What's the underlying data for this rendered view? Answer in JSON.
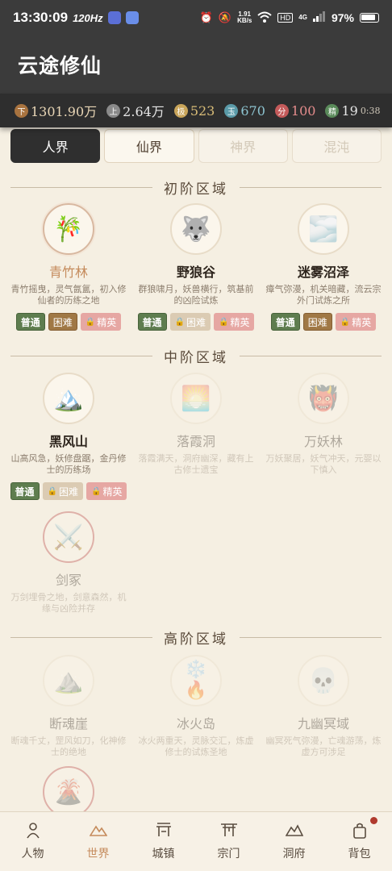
{
  "status_bar": {
    "time": "13:30:09",
    "refresh_rate": "120Hz",
    "net_speed_value": "1.91",
    "net_speed_unit": "KB/s",
    "net_type": "4G",
    "battery": "97%"
  },
  "app": {
    "title": "云途修仙"
  },
  "resources": [
    {
      "icon_text": "下",
      "value": "1301.90万",
      "color": "#a8733f"
    },
    {
      "icon_text": "上",
      "value": "2.64万",
      "color": "#8a8a8a"
    },
    {
      "icon_text": "极",
      "value": "523",
      "color": "#c9a55a"
    },
    {
      "icon_text": "玉",
      "value": "670",
      "color": "#5a9aa8"
    },
    {
      "icon_text": "分",
      "value": "100",
      "color": "#c45a5a"
    },
    {
      "icon_text": "精",
      "value": "19",
      "color": "#5a8a5a"
    }
  ],
  "resource_timer": "0:38",
  "tabs": [
    "人界",
    "仙界",
    "神界",
    "混沌"
  ],
  "sections": {
    "s1": "初阶区域",
    "s2": "中阶区域",
    "s3": "高阶区域"
  },
  "difficulty": {
    "normal": "普通",
    "hard": "困难",
    "elite": "精英"
  },
  "locations": {
    "l1": {
      "name": "青竹林",
      "desc": "青竹摇曳，灵气氤氲，初入修仙者的历练之地",
      "icon": "bamboo-icon"
    },
    "l2": {
      "name": "野狼谷",
      "desc": "群狼啸月，妖兽横行，筑基前的凶险试炼",
      "icon": "wolf-icon"
    },
    "l3": {
      "name": "迷雾沼泽",
      "desc": "瘴气弥漫，机关暗藏，流云宗外门试炼之所",
      "icon": "fog-icon"
    },
    "l4": {
      "name": "黑风山",
      "desc": "山高风急，妖修盘踞，金丹修士的历练场",
      "icon": "mountain-icon"
    },
    "l5": {
      "name": "落霞洞",
      "desc": "落霞满天，洞府幽深，藏有上古修士遗宝",
      "icon": "sunset-icon"
    },
    "l6": {
      "name": "万妖林",
      "desc": "万妖聚居，妖气冲天，元婴以下慎入",
      "icon": "demon-mask-icon"
    },
    "l7": {
      "name": "剑冢",
      "desc": "万剑埋骨之地，剑意森然，机缘与凶险并存",
      "icon": "crossed-swords-icon"
    },
    "l8": {
      "name": "断魂崖",
      "desc": "断魂千丈，罡风如刀，化神修士的绝地",
      "icon": "cliff-icon"
    },
    "l9": {
      "name": "冰火岛",
      "desc": "冰火两重天，灵脉交汇，炼虚修士的试炼圣地",
      "icon": "ice-fire-icon"
    },
    "l10": {
      "name": "九幽冥域",
      "desc": "幽冥死气弥漫，亡魂游荡，炼虚方可涉足",
      "icon": "skull-icon"
    }
  },
  "bottom_nav": [
    "人物",
    "世界",
    "城镇",
    "宗门",
    "洞府",
    "背包"
  ]
}
